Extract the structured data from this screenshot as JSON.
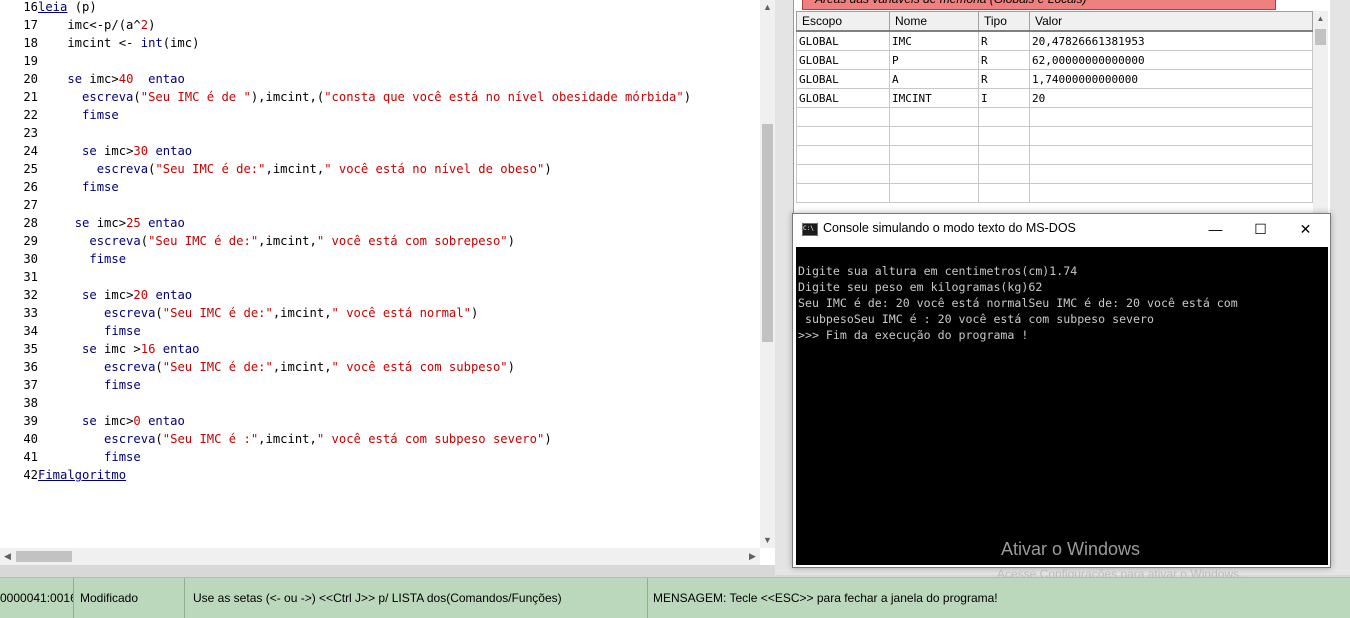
{
  "editor": {
    "lines": [
      {
        "n": "16",
        "tokens": [
          {
            "t": "leia",
            "c": "kw",
            "u": true
          },
          {
            "t": " (p)"
          }
        ]
      },
      {
        "n": "17",
        "tokens": [
          {
            "t": "    imc<-p/(a^"
          },
          {
            "t": "2",
            "c": "num"
          },
          {
            "t": ")"
          }
        ]
      },
      {
        "n": "18",
        "tokens": [
          {
            "t": "    imcint <- "
          },
          {
            "t": "int",
            "c": "fn"
          },
          {
            "t": "(imc)"
          }
        ]
      },
      {
        "n": "19",
        "tokens": []
      },
      {
        "n": "20",
        "tokens": [
          {
            "t": "    "
          },
          {
            "t": "se",
            "c": "kw"
          },
          {
            "t": " imc>"
          },
          {
            "t": "40",
            "c": "num"
          },
          {
            "t": "  "
          },
          {
            "t": "entao",
            "c": "kw"
          }
        ]
      },
      {
        "n": "21",
        "tokens": [
          {
            "t": "      "
          },
          {
            "t": "escreva",
            "c": "kw"
          },
          {
            "t": "("
          },
          {
            "t": "\"Seu IMC é de \"",
            "c": "str"
          },
          {
            "t": "),imcint,("
          },
          {
            "t": "\"consta que você está no nível obesidade mórbida\"",
            "c": "str"
          },
          {
            "t": ")"
          }
        ]
      },
      {
        "n": "22",
        "tokens": [
          {
            "t": "      "
          },
          {
            "t": "fimse",
            "c": "kw"
          }
        ]
      },
      {
        "n": "23",
        "tokens": []
      },
      {
        "n": "24",
        "tokens": [
          {
            "t": "      "
          },
          {
            "t": "se",
            "c": "kw"
          },
          {
            "t": " imc>"
          },
          {
            "t": "30",
            "c": "num"
          },
          {
            "t": " "
          },
          {
            "t": "entao",
            "c": "kw"
          }
        ]
      },
      {
        "n": "25",
        "tokens": [
          {
            "t": "        "
          },
          {
            "t": "escreva",
            "c": "kw"
          },
          {
            "t": "("
          },
          {
            "t": "\"Seu IMC é de:\"",
            "c": "str"
          },
          {
            "t": ",imcint,"
          },
          {
            "t": "\" você está no nível de obeso\"",
            "c": "str"
          },
          {
            "t": ")"
          }
        ]
      },
      {
        "n": "26",
        "tokens": [
          {
            "t": "      "
          },
          {
            "t": "fimse",
            "c": "kw"
          }
        ]
      },
      {
        "n": "27",
        "tokens": []
      },
      {
        "n": "28",
        "tokens": [
          {
            "t": "     "
          },
          {
            "t": "se",
            "c": "kw"
          },
          {
            "t": " imc>"
          },
          {
            "t": "25",
            "c": "num"
          },
          {
            "t": " "
          },
          {
            "t": "entao",
            "c": "kw"
          }
        ]
      },
      {
        "n": "29",
        "tokens": [
          {
            "t": "       "
          },
          {
            "t": "escreva",
            "c": "kw"
          },
          {
            "t": "("
          },
          {
            "t": "\"Seu IMC é de:\"",
            "c": "str"
          },
          {
            "t": ",imcint,"
          },
          {
            "t": "\" você está com sobrepeso\"",
            "c": "str"
          },
          {
            "t": ")"
          }
        ]
      },
      {
        "n": "30",
        "tokens": [
          {
            "t": "       "
          },
          {
            "t": "fimse",
            "c": "kw"
          }
        ]
      },
      {
        "n": "31",
        "tokens": []
      },
      {
        "n": "32",
        "tokens": [
          {
            "t": "      "
          },
          {
            "t": "se",
            "c": "kw"
          },
          {
            "t": " imc>"
          },
          {
            "t": "20",
            "c": "num"
          },
          {
            "t": " "
          },
          {
            "t": "entao",
            "c": "kw"
          }
        ]
      },
      {
        "n": "33",
        "tokens": [
          {
            "t": "         "
          },
          {
            "t": "escreva",
            "c": "kw"
          },
          {
            "t": "("
          },
          {
            "t": "\"Seu IMC é de:\"",
            "c": "str"
          },
          {
            "t": ",imcint,"
          },
          {
            "t": "\" você está normal\"",
            "c": "str"
          },
          {
            "t": ")"
          }
        ]
      },
      {
        "n": "34",
        "tokens": [
          {
            "t": "         "
          },
          {
            "t": "fimse",
            "c": "kw"
          }
        ]
      },
      {
        "n": "35",
        "tokens": [
          {
            "t": "      "
          },
          {
            "t": "se",
            "c": "kw"
          },
          {
            "t": " imc >"
          },
          {
            "t": "16",
            "c": "num"
          },
          {
            "t": " "
          },
          {
            "t": "entao",
            "c": "kw"
          }
        ]
      },
      {
        "n": "36",
        "tokens": [
          {
            "t": "         "
          },
          {
            "t": "escreva",
            "c": "kw"
          },
          {
            "t": "("
          },
          {
            "t": "\"Seu IMC é de:\"",
            "c": "str"
          },
          {
            "t": ",imcint,"
          },
          {
            "t": "\" você está com subpeso\"",
            "c": "str"
          },
          {
            "t": ")"
          }
        ]
      },
      {
        "n": "37",
        "tokens": [
          {
            "t": "         "
          },
          {
            "t": "fimse",
            "c": "kw"
          }
        ]
      },
      {
        "n": "38",
        "tokens": []
      },
      {
        "n": "39",
        "tokens": [
          {
            "t": "      "
          },
          {
            "t": "se",
            "c": "kw"
          },
          {
            "t": " imc>"
          },
          {
            "t": "0",
            "c": "num"
          },
          {
            "t": " "
          },
          {
            "t": "entao",
            "c": "kw"
          }
        ]
      },
      {
        "n": "40",
        "tokens": [
          {
            "t": "         "
          },
          {
            "t": "escreva",
            "c": "kw"
          },
          {
            "t": "("
          },
          {
            "t": "\"Seu IMC é :\"",
            "c": "str"
          },
          {
            "t": ",imcint,"
          },
          {
            "t": "\" você está com subpeso severo\"",
            "c": "str"
          },
          {
            "t": ")"
          }
        ]
      },
      {
        "n": "41",
        "tokens": [
          {
            "t": "         "
          },
          {
            "t": "fimse",
            "c": "kw"
          }
        ]
      },
      {
        "n": "42",
        "tokens": [
          {
            "t": "Fimalgoritmo",
            "c": "link"
          }
        ]
      }
    ]
  },
  "variables": {
    "header": "Áreas das variáveis de memória (Globais e Locais)",
    "columns": [
      "Escopo",
      "Nome",
      "Tipo",
      "Valor"
    ],
    "rows": [
      [
        "GLOBAL",
        "IMC",
        "R",
        "20,47826661381953"
      ],
      [
        "GLOBAL",
        "P",
        "R",
        "62,00000000000000"
      ],
      [
        "GLOBAL",
        "A",
        "R",
        "1,74000000000000"
      ],
      [
        "GLOBAL",
        "IMCINT",
        "I",
        "20"
      ]
    ]
  },
  "console": {
    "title": "Console simulando o modo texto do MS-DOS",
    "icon_text": "C:\\",
    "min_glyph": "—",
    "max_glyph": "☐",
    "close_glyph": "✕",
    "lines": [
      "Digite sua altura em centimetros(cm)1.74",
      "Digite seu peso em kilogramas(kg)62",
      "Seu IMC é de: 20 você está normalSeu IMC é de: 20 você está com",
      " subpesoSeu IMC é : 20 você está com subpeso severo",
      ">>> Fim da execução do programa !"
    ]
  },
  "watermark": {
    "line1": "Ativar o Windows",
    "line2": "Acesse Configurações para ativar o Windows."
  },
  "statusbar": {
    "position": "0000041:0016",
    "state": "Modificado",
    "hint": "Use as setas (<- ou ->) <<Ctrl J>> p/ LISTA dos(Comandos/Funções)",
    "message": "MENSAGEM: Tecle <<ESC>> para fechar a janela do programa!"
  },
  "colors": {
    "keyword": "#00007f",
    "string": "#cc0000",
    "statusbar_bg": "#bcd8bc",
    "var_header_bg": "#f08080",
    "console_bg": "#000000"
  },
  "icons": {
    "scroll_up": "▲",
    "scroll_down": "▼",
    "scroll_left": "◀",
    "scroll_right": "▶"
  }
}
